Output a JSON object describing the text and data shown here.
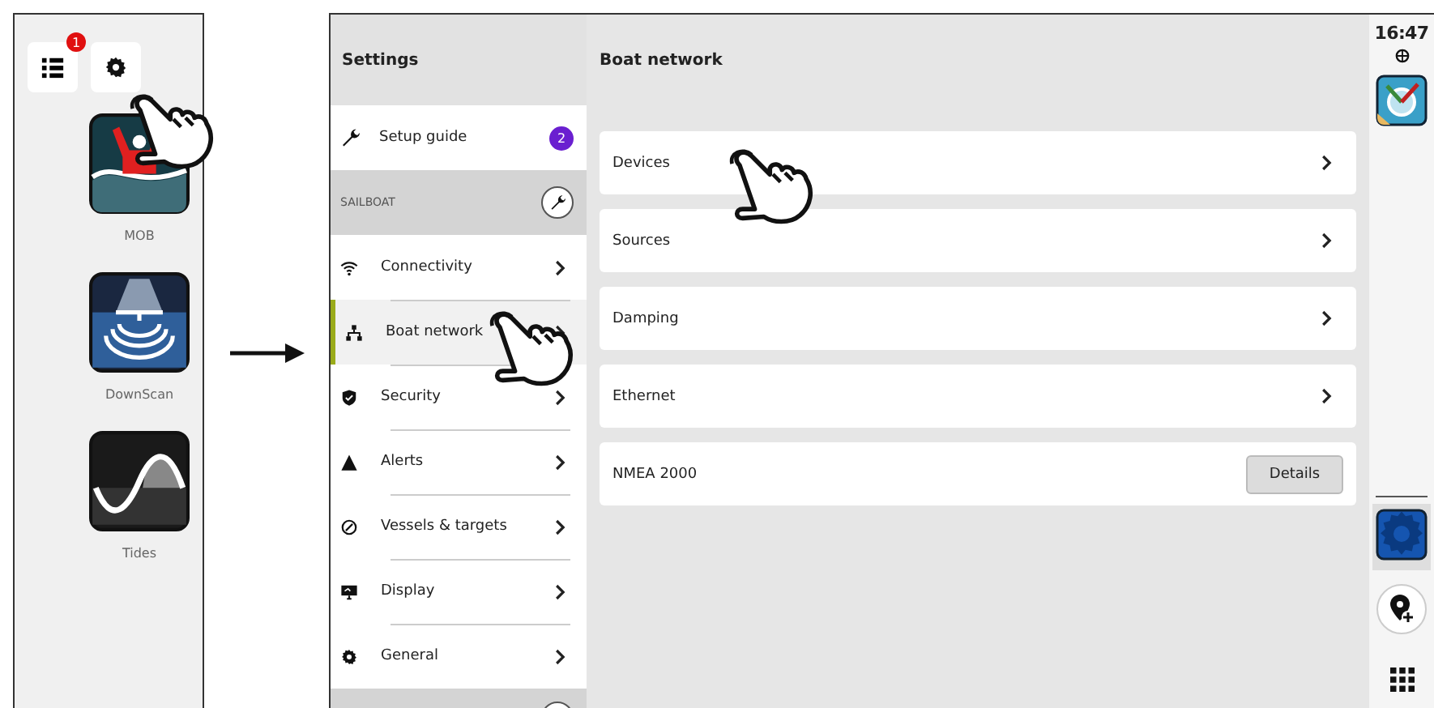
{
  "launcher": {
    "tools": [
      {
        "kind": "list",
        "badge": "1"
      },
      {
        "kind": "settings"
      }
    ],
    "apps": [
      {
        "kind": "mob",
        "label": "MOB"
      },
      {
        "kind": "downscan",
        "label": "DownScan"
      },
      {
        "kind": "tides",
        "label": "Tides"
      }
    ]
  },
  "menu": {
    "title": "Settings",
    "setup_guide": {
      "label": "Setup guide",
      "badge": "2"
    },
    "section": "SAILBOAT",
    "items": [
      {
        "kind": "wifi",
        "label": "Connectivity",
        "selected": false
      },
      {
        "kind": "network",
        "label": "Boat network",
        "selected": true
      },
      {
        "kind": "shield",
        "label": "Security",
        "selected": false
      },
      {
        "kind": "warning",
        "label": "Alerts",
        "selected": false
      },
      {
        "kind": "gauge",
        "label": "Vessels & targets",
        "selected": false
      },
      {
        "kind": "monitor",
        "label": "Display",
        "selected": false
      },
      {
        "kind": "gear",
        "label": "General",
        "selected": false
      }
    ]
  },
  "page": {
    "title": "Boat network",
    "rows": [
      {
        "kind": "link",
        "label": "Devices"
      },
      {
        "kind": "link",
        "label": "Sources"
      },
      {
        "kind": "link",
        "label": "Damping"
      },
      {
        "kind": "link",
        "label": "Ethernet"
      },
      {
        "kind": "button",
        "label": "NMEA 2000",
        "button": "Details"
      }
    ]
  },
  "status_bar": {
    "time": "16:47",
    "apps": [
      {
        "kind": "compass",
        "selected": false
      },
      {
        "kind": "settings",
        "selected": true
      }
    ],
    "tools": [
      {
        "kind": "add-waypoint"
      },
      {
        "kind": "grid"
      }
    ]
  }
}
